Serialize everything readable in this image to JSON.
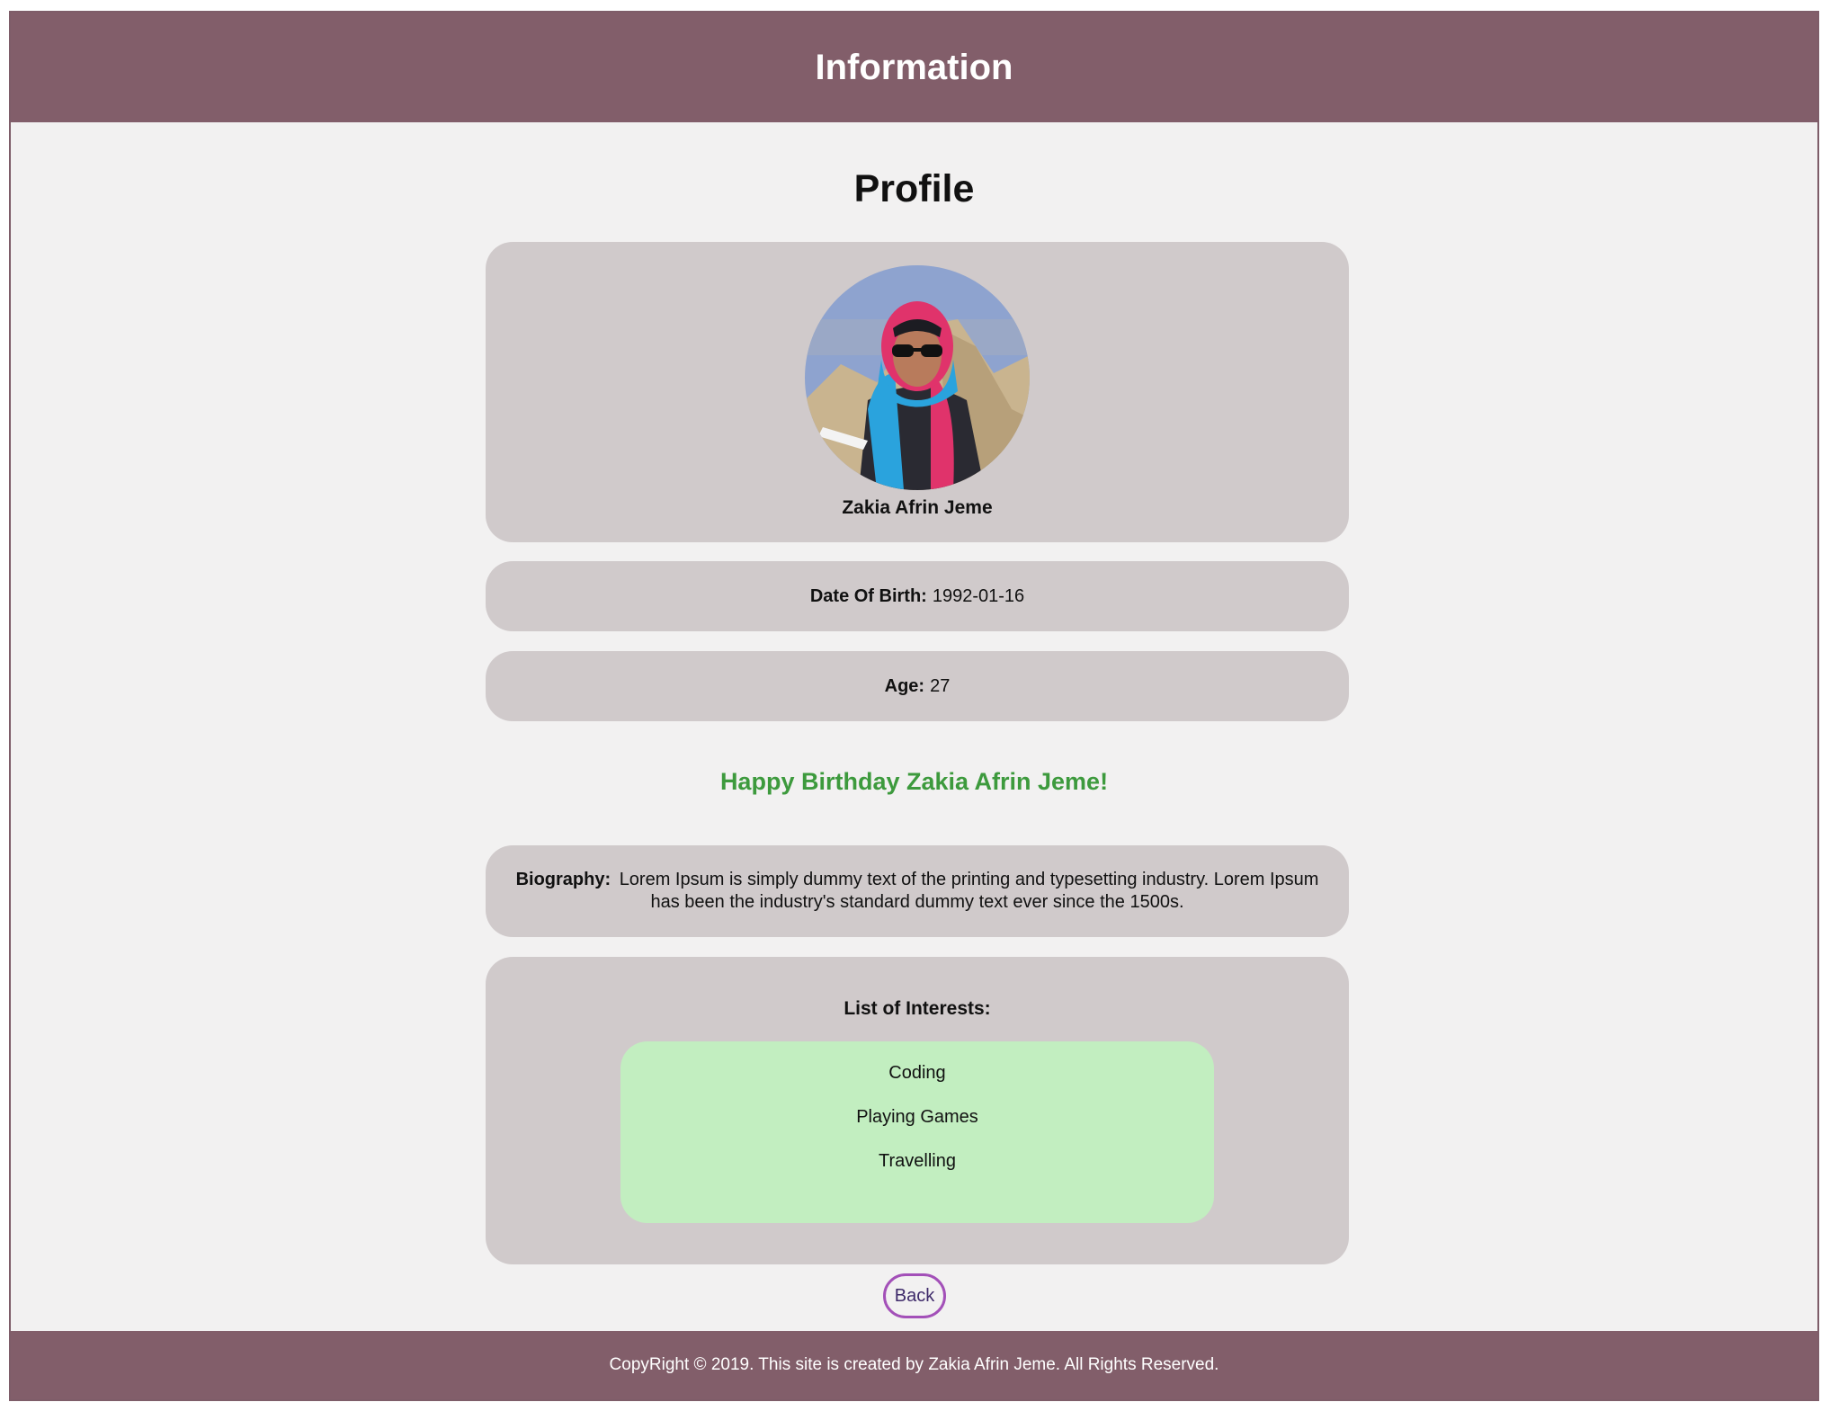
{
  "header": {
    "title": "Information"
  },
  "profile": {
    "heading": "Profile",
    "name": "Zakia Afrin Jeme",
    "avatar_icon": "profile-photo"
  },
  "details": {
    "dob_label": "Date Of Birth:",
    "dob_value": "1992-01-16",
    "age_label": "Age:",
    "age_value": "27"
  },
  "greeting": "Happy Birthday Zakia Afrin Jeme!",
  "biography": {
    "label": "Biography:",
    "text": "Lorem Ipsum is simply dummy text of the printing and typesetting industry. Lorem Ipsum has been the industry's standard dummy text ever since the 1500s."
  },
  "interests": {
    "title": "List of Interests:",
    "items": [
      "Coding",
      "Playing Games",
      "Travelling"
    ]
  },
  "back_button": {
    "label": "Back"
  },
  "footer": {
    "text": "CopyRight © 2019. This site is created by Zakia Afrin Jeme. All Rights Reserved."
  },
  "colors": {
    "bar": "#825e6a",
    "page_bg": "#f2f1f1",
    "card": "#d0cacb",
    "interests_box": "#c2eec0",
    "greeting": "#3d9a3d",
    "back_border": "#a350b8"
  }
}
